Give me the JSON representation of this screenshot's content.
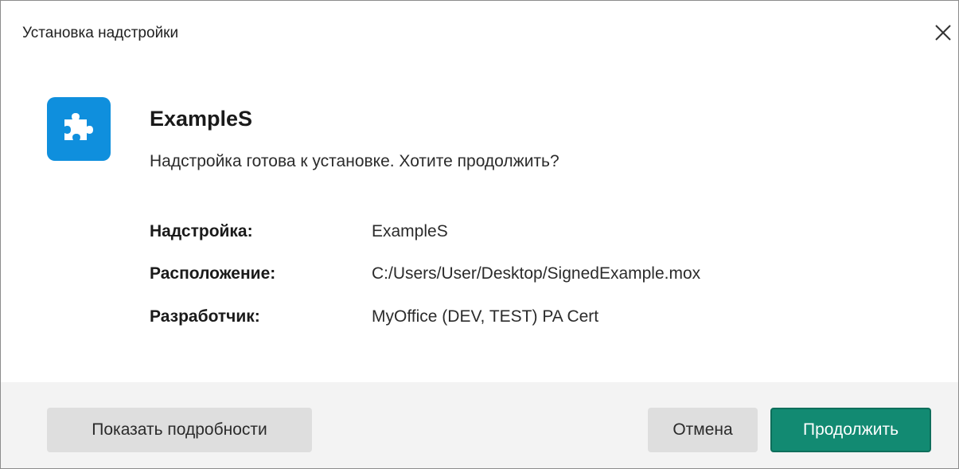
{
  "window": {
    "title": "Установка надстройки"
  },
  "addin": {
    "name": "ExampleS",
    "prompt": "Надстройка готова к установке. Хотите продолжить?",
    "icon": "puzzle-piece-icon",
    "icon_color": "#0f8fdd"
  },
  "details": [
    {
      "label": "Надстройка:",
      "value": "ExampleS"
    },
    {
      "label": "Расположение:",
      "value": "C:/Users/User/Desktop/SignedExample.mox"
    },
    {
      "label": "Разработчик:",
      "value": "MyOffice (DEV, TEST) PA Cert"
    }
  ],
  "buttons": {
    "details": "Показать подробности",
    "cancel": "Отмена",
    "continue": "Продолжить"
  },
  "colors": {
    "primary_button": "#128a72",
    "secondary_button": "#dedede",
    "footer_background": "#f3f3f3"
  }
}
